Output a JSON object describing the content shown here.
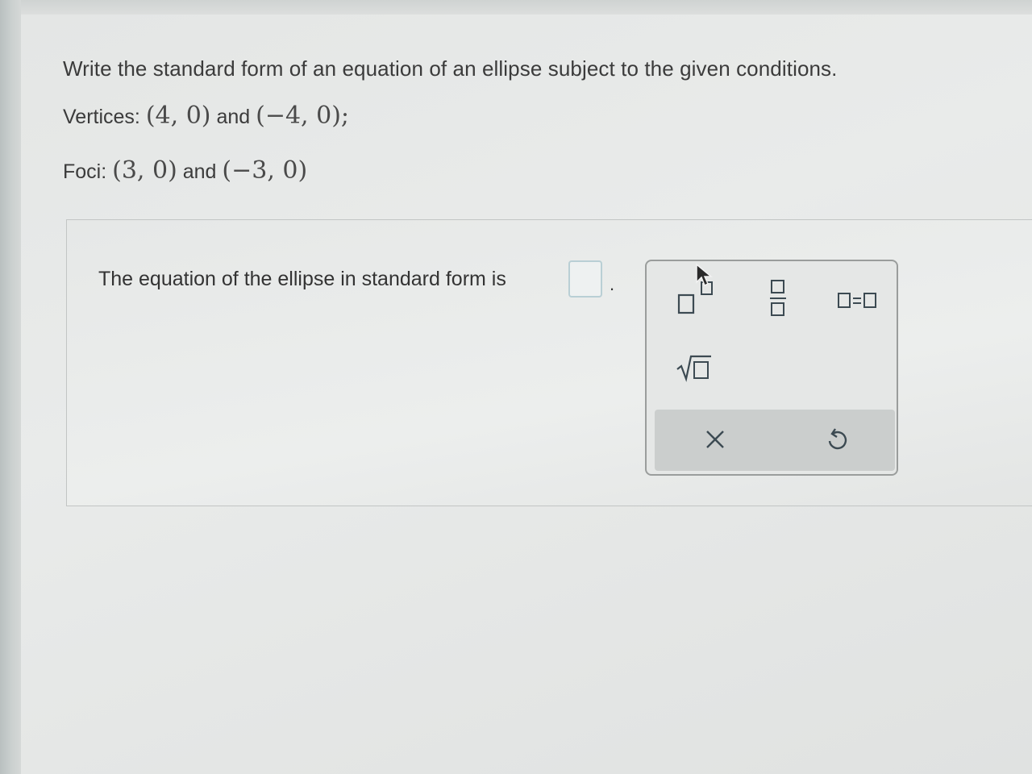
{
  "question": {
    "instruction": "Write the standard form of an equation of an ellipse subject to the given conditions.",
    "vertices_label": "Vertices:",
    "vertex1": "(4, 0)",
    "vertices_joiner": "and",
    "vertex2": "(−4, 0);",
    "foci_label": "Foci:",
    "focus1": "(3, 0)",
    "foci_joiner": "and",
    "focus2": "(−3, 0)"
  },
  "answer": {
    "prompt": "The equation of the ellipse in standard form is",
    "input_value": "",
    "trailing_punctuation": "."
  },
  "palette": {
    "tools": [
      "exponent-icon",
      "fraction-icon",
      "equation-icon",
      "square-root-icon"
    ],
    "actions": [
      "clear-icon",
      "undo-icon"
    ],
    "accent": "#2c8fa3",
    "icon_color": "#3c4a52"
  }
}
